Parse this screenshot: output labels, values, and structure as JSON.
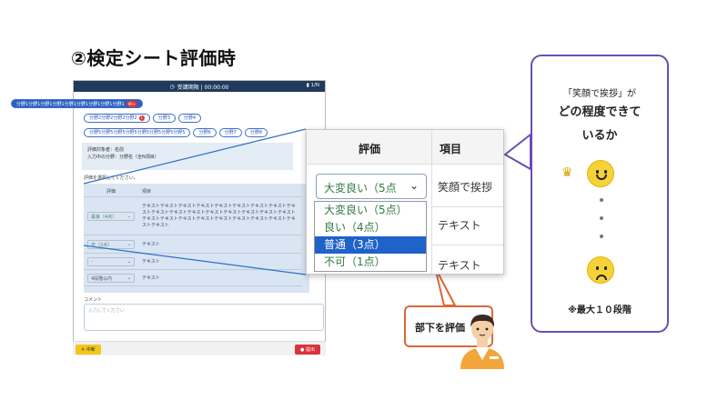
{
  "heading": "②検定シート評価時",
  "screenshot": {
    "topbar_title": "受講期限 | 00:00:00",
    "topbar_page": "1/N",
    "pills_row1": [
      {
        "label": "分野1分野1分野1分野1分野1分野1分野1分野1分野1",
        "badge": "99+",
        "active": true
      }
    ],
    "pills_row2": [
      {
        "label": "分野2分野2分野2分野2",
        "dot": "1"
      },
      {
        "label": "分野3"
      },
      {
        "label": "分野4"
      }
    ],
    "pills_row3": [
      {
        "label": "分野5分野5分野5分野5分野5分野5分野5分野5"
      },
      {
        "label": "分野6"
      },
      {
        "label": "分野7"
      },
      {
        "label": "分野8"
      }
    ],
    "info_line1": "評価対象者：名前",
    "info_line2": "入力中の分野：分野名（全N項目）",
    "prompt": "評価を選択してください。",
    "col_eval": "評価",
    "col_item": "項目",
    "rows": [
      {
        "eval": "最良（4点）",
        "item": "テキストテキストテキストテキストテキストテキストテキストテキストテキストテキストテキストテキストテキストテキストテキストテキストテキストテキストテキストテキストテキストテキストテキストテキストテキストテキストテキスト"
      },
      {
        "eval": "可（2点）",
        "item": "テキスト"
      },
      {
        "eval": "-",
        "item": "テキスト"
      },
      {
        "eval": "4段階以内",
        "item": "テキスト"
      }
    ],
    "comment_label": "コメント",
    "comment_placeholder": "入力してください",
    "cancel_label": "✕ 中断",
    "submit_label": "提出"
  },
  "zoom": {
    "col_eval": "評価",
    "col_item": "項目",
    "selected_value": "大変良い（5点",
    "options": [
      "大変良い（5点）",
      "良い（4点）",
      "普通（3点）",
      "不可（1点）"
    ],
    "selected_option_index": 2,
    "item1": "笑顔で挨拶",
    "item2": "テキスト",
    "item3": "テキスト"
  },
  "bubble": {
    "line1": "「笑顔で挨拶」が",
    "line2": "どの程度できて",
    "line3": "いるか",
    "note": "※最大１０段階"
  },
  "callout": {
    "text": "部下を評価"
  },
  "colors": {
    "bubble_border": "#6a4fb0",
    "callout_border": "#d9683a",
    "selected_option": "#1f62c9",
    "option_text": "#2f7a3f"
  }
}
